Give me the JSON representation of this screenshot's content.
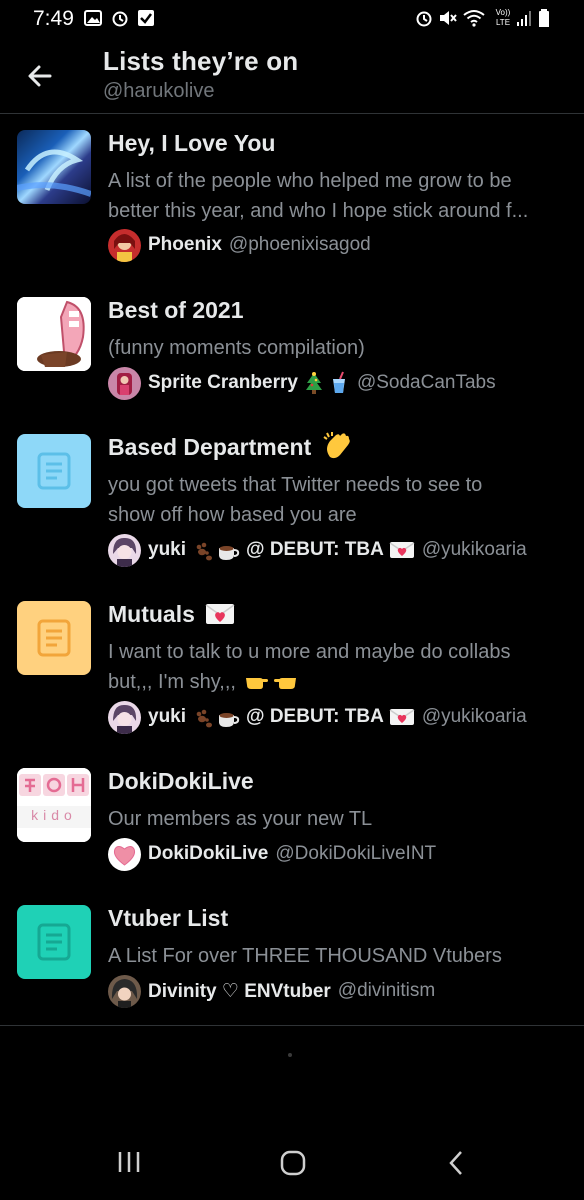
{
  "status_bar": {
    "time": "7:49",
    "network": "Vo)) LTE"
  },
  "header": {
    "title": "Lists they’re on",
    "subtitle": "@harukolive"
  },
  "lists": [
    {
      "name": "Hey, I Love You",
      "description_lines": [
        "A list of the people who helped me grow to be",
        "better this year, and who I hope stick around f..."
      ],
      "owner_name": "Phoenix",
      "owner_handle": "@phoenixisagod"
    },
    {
      "name": "Best of 2021",
      "description_lines": [
        "(funny moments compilation)"
      ],
      "owner_name": "Sprite Cranberry",
      "owner_handle": "@SodaCanTabs"
    },
    {
      "name": "Based Department",
      "description_lines": [
        "you got tweets that Twitter needs to see to",
        "show off how based you are"
      ],
      "owner_name": "yuki",
      "owner_name_suffix": "@ DEBUT: TBA",
      "owner_handle": "@yukikoaria"
    },
    {
      "name": "Mutuals",
      "description_lines": [
        "I want to talk to u more and maybe do collabs",
        "but,,, I'm shy,,,"
      ],
      "owner_name": "yuki",
      "owner_name_suffix": "@ DEBUT: TBA",
      "owner_handle": "@yukikoaria"
    },
    {
      "name": "DokiDokiLive",
      "description_lines": [
        "Our members as your new TL"
      ],
      "owner_name": "DokiDokiLive",
      "owner_handle": "@DokiDokiLiveINT",
      "thumb_text": "kido"
    },
    {
      "name": "Vtuber List",
      "description_lines": [
        "A List For over THREE THOUSAND Vtubers"
      ],
      "owner_name": "Divinity ♡ ENVtuber",
      "owner_handle": "@divinitism"
    }
  ],
  "colors": {
    "background": "#000000",
    "primary_text": "#e7e9ea",
    "secondary_text": "#8b9096",
    "divider": "#2f3336",
    "list_icon_blue": "#8ed8f8",
    "list_icon_orange": "#ffd17f",
    "list_icon_teal": "#1fd1b6"
  },
  "icons": {
    "back": "arrow-left-icon",
    "list": "list-document-icon",
    "nav_recents": "recents-icon",
    "nav_home": "home-icon",
    "nav_back": "chevron-left-icon"
  }
}
